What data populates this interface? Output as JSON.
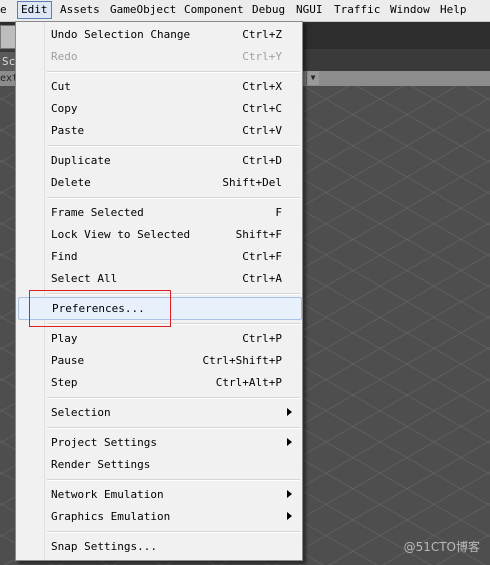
{
  "menubar": {
    "items": [
      "e",
      "Edit",
      "Assets",
      "GameObject",
      "Component",
      "Debug",
      "NGUI",
      "Traffic",
      "Window",
      "Help"
    ],
    "active": "Edit"
  },
  "scene": {
    "tab_label": "Sc",
    "row_label": "extu"
  },
  "edit_menu": {
    "groups": [
      [
        {
          "label": "Undo Selection Change",
          "shortcut": "Ctrl+Z"
        },
        {
          "label": "Redo",
          "shortcut": "Ctrl+Y",
          "disabled": true
        }
      ],
      [
        {
          "label": "Cut",
          "shortcut": "Ctrl+X"
        },
        {
          "label": "Copy",
          "shortcut": "Ctrl+C"
        },
        {
          "label": "Paste",
          "shortcut": "Ctrl+V"
        }
      ],
      [
        {
          "label": "Duplicate",
          "shortcut": "Ctrl+D"
        },
        {
          "label": "Delete",
          "shortcut": "Shift+Del"
        }
      ],
      [
        {
          "label": "Frame Selected",
          "shortcut": "F"
        },
        {
          "label": "Lock View to Selected",
          "shortcut": "Shift+F"
        },
        {
          "label": "Find",
          "shortcut": "Ctrl+F"
        },
        {
          "label": "Select All",
          "shortcut": "Ctrl+A"
        }
      ],
      [
        {
          "label": "Preferences...",
          "shortcut": "",
          "hovered": true
        }
      ],
      [
        {
          "label": "Play",
          "shortcut": "Ctrl+P"
        },
        {
          "label": "Pause",
          "shortcut": "Ctrl+Shift+P"
        },
        {
          "label": "Step",
          "shortcut": "Ctrl+Alt+P"
        }
      ],
      [
        {
          "label": "Selection",
          "shortcut": "",
          "submenu": true
        }
      ],
      [
        {
          "label": "Project Settings",
          "shortcut": "",
          "submenu": true
        },
        {
          "label": "Render Settings",
          "shortcut": ""
        }
      ],
      [
        {
          "label": "Network Emulation",
          "shortcut": "",
          "submenu": true
        },
        {
          "label": "Graphics Emulation",
          "shortcut": "",
          "submenu": true
        }
      ],
      [
        {
          "label": "Snap Settings...",
          "shortcut": ""
        }
      ]
    ]
  },
  "watermark": "@51CTO博客"
}
